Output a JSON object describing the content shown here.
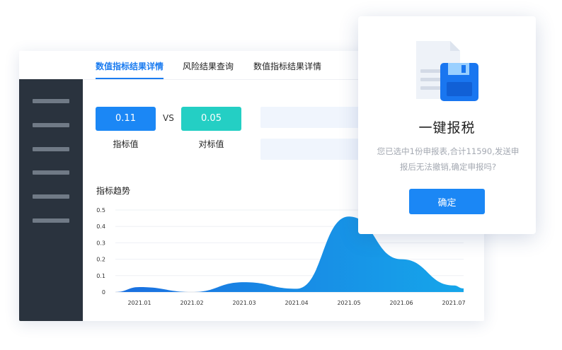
{
  "tabs": [
    {
      "label": "数值指标结果详情",
      "active": true
    },
    {
      "label": "风险结果查询",
      "active": false
    },
    {
      "label": "数值指标结果详情",
      "active": false
    }
  ],
  "comparison": {
    "indicator": {
      "value": "0.11",
      "label": "指标值",
      "color": "#1b87f5"
    },
    "vs_label": "VS",
    "target": {
      "value": "0.05",
      "label": "对标值",
      "color": "#24cfc4"
    }
  },
  "trend": {
    "title": "指标趋势"
  },
  "chart_data": {
    "type": "area",
    "x": [
      "2021.01",
      "2021.02",
      "2021.03",
      "2021.04",
      "2021.05",
      "2021.06",
      "2021.07"
    ],
    "yticks": [
      "0",
      "0.1",
      "0.2",
      "0.3",
      "0.4",
      "0.5"
    ],
    "ylim": [
      0,
      0.5
    ],
    "series": [
      {
        "values": [
          0.03,
          0.0,
          0.06,
          0.02,
          0.46,
          0.2,
          0.04
        ]
      }
    ],
    "grid": true,
    "gradient_colors": [
      "#1a6fe0",
      "#16a6ea"
    ]
  },
  "modal": {
    "title": "一键报税",
    "message": "您已选中1份申报表,合计11590,发送申报后无法撤销,确定申报吗?",
    "confirm_label": "确定",
    "icon": "floppy-save-icon"
  }
}
